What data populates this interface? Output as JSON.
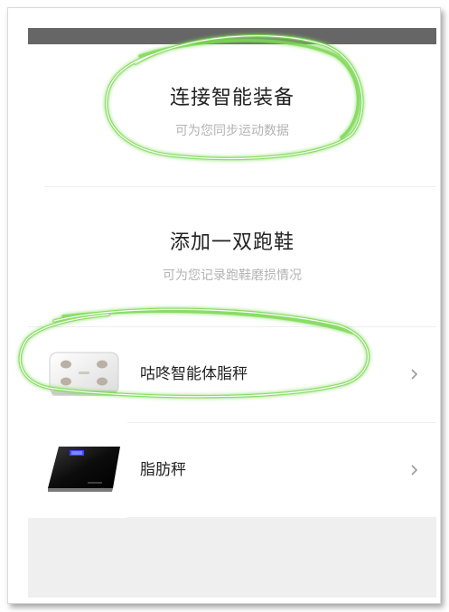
{
  "connect_section": {
    "title": "连接智能装备",
    "subtitle": "可为您同步运动数据"
  },
  "shoes_section": {
    "title": "添加一双跑鞋",
    "subtitle": "可为您记录跑鞋磨损情况"
  },
  "devices": [
    {
      "label": "咕咚智能体脂秤",
      "icon": "white-body-fat-scale-icon"
    },
    {
      "label": "脂肪秤",
      "icon": "black-fat-scale-icon"
    }
  ],
  "colors": {
    "status_bar": "#666666",
    "highlight": "#7ed957",
    "footer_bg": "#efefef"
  }
}
